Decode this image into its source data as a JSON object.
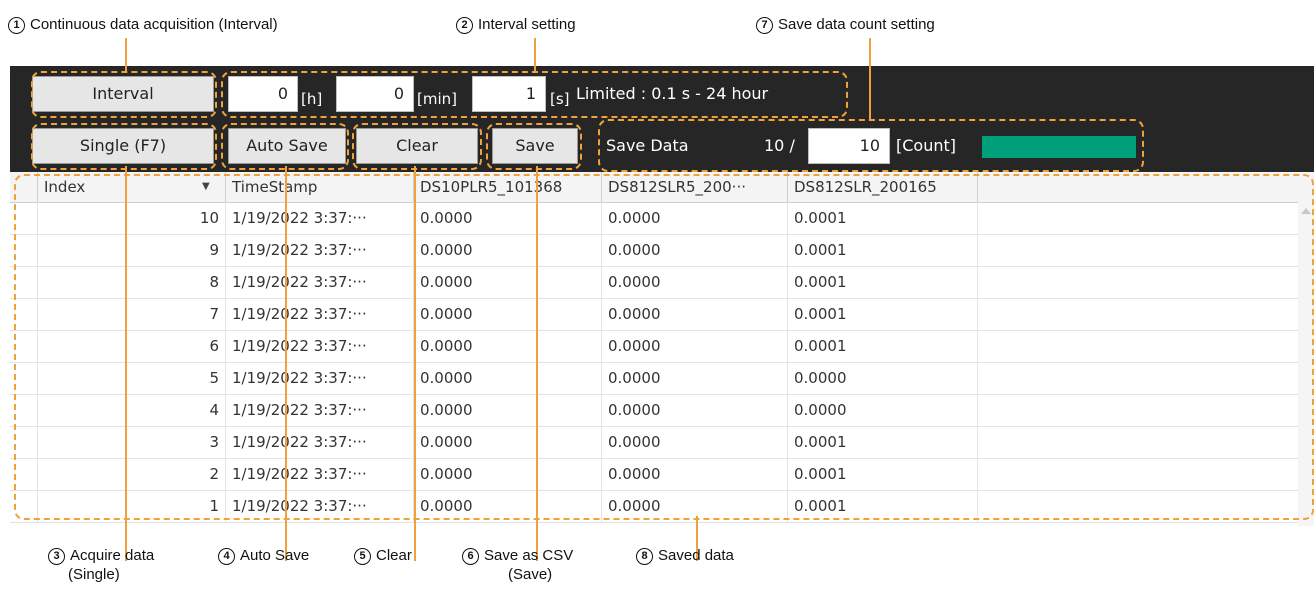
{
  "annotations": {
    "a1": {
      "num": "1",
      "text": "Continuous data acquisition (Interval)"
    },
    "a2": {
      "num": "2",
      "text": "Interval setting"
    },
    "a7": {
      "num": "7",
      "text": "Save data count setting"
    },
    "a3": {
      "num": "3",
      "line1": "Acquire data",
      "line2": "(Single)"
    },
    "a4": {
      "num": "4",
      "text": "Auto Save"
    },
    "a5": {
      "num": "5",
      "text": "Clear"
    },
    "a6": {
      "num": "6",
      "line1": "Save as CSV",
      "line2": "(Save)"
    },
    "a8": {
      "num": "8",
      "text": "Saved data"
    }
  },
  "toolbar": {
    "interval_button": "Interval",
    "hours_value": "0",
    "hours_unit": "[h]",
    "minutes_value": "0",
    "minutes_unit": "[min]",
    "seconds_value": "1",
    "seconds_unit": "[s]",
    "limit_text": "Limited : 0.1 s - 24 hour",
    "single_button": "Single (F7)",
    "auto_save_button": "Auto Save",
    "clear_button": "Clear",
    "save_button": "Save",
    "save_data_label": "Save Data",
    "save_data_current": "10 /",
    "save_data_count": "10",
    "count_unit": "[Count]",
    "progress_fraction": 1.0,
    "progress_color": "#00a07a"
  },
  "grid": {
    "columns": [
      "Index",
      "TimeStamp",
      "DS10PLR5_101368",
      "DS812SLR5_200···",
      "DS812SLR_200165"
    ],
    "sort_icon": "sort-down-icon",
    "rows": [
      [
        "10",
        "1/19/2022 3:37:···",
        "0.0000",
        "0.0000",
        "0.0001"
      ],
      [
        "9",
        "1/19/2022 3:37:···",
        "0.0000",
        "0.0000",
        "0.0001"
      ],
      [
        "8",
        "1/19/2022 3:37:···",
        "0.0000",
        "0.0000",
        "0.0001"
      ],
      [
        "7",
        "1/19/2022 3:37:···",
        "0.0000",
        "0.0000",
        "0.0001"
      ],
      [
        "6",
        "1/19/2022 3:37:···",
        "0.0000",
        "0.0000",
        "0.0001"
      ],
      [
        "5",
        "1/19/2022 3:37:···",
        "0.0000",
        "0.0000",
        "0.0000"
      ],
      [
        "4",
        "1/19/2022 3:37:···",
        "0.0000",
        "0.0000",
        "0.0000"
      ],
      [
        "3",
        "1/19/2022 3:37:···",
        "0.0000",
        "0.0000",
        "0.0001"
      ],
      [
        "2",
        "1/19/2022 3:37:···",
        "0.0000",
        "0.0000",
        "0.0001"
      ],
      [
        "1",
        "1/19/2022 3:37:···",
        "0.0000",
        "0.0000",
        "0.0001"
      ]
    ]
  },
  "colors": {
    "annotation": "#f0a23a",
    "toolbar_bg": "#262626"
  }
}
